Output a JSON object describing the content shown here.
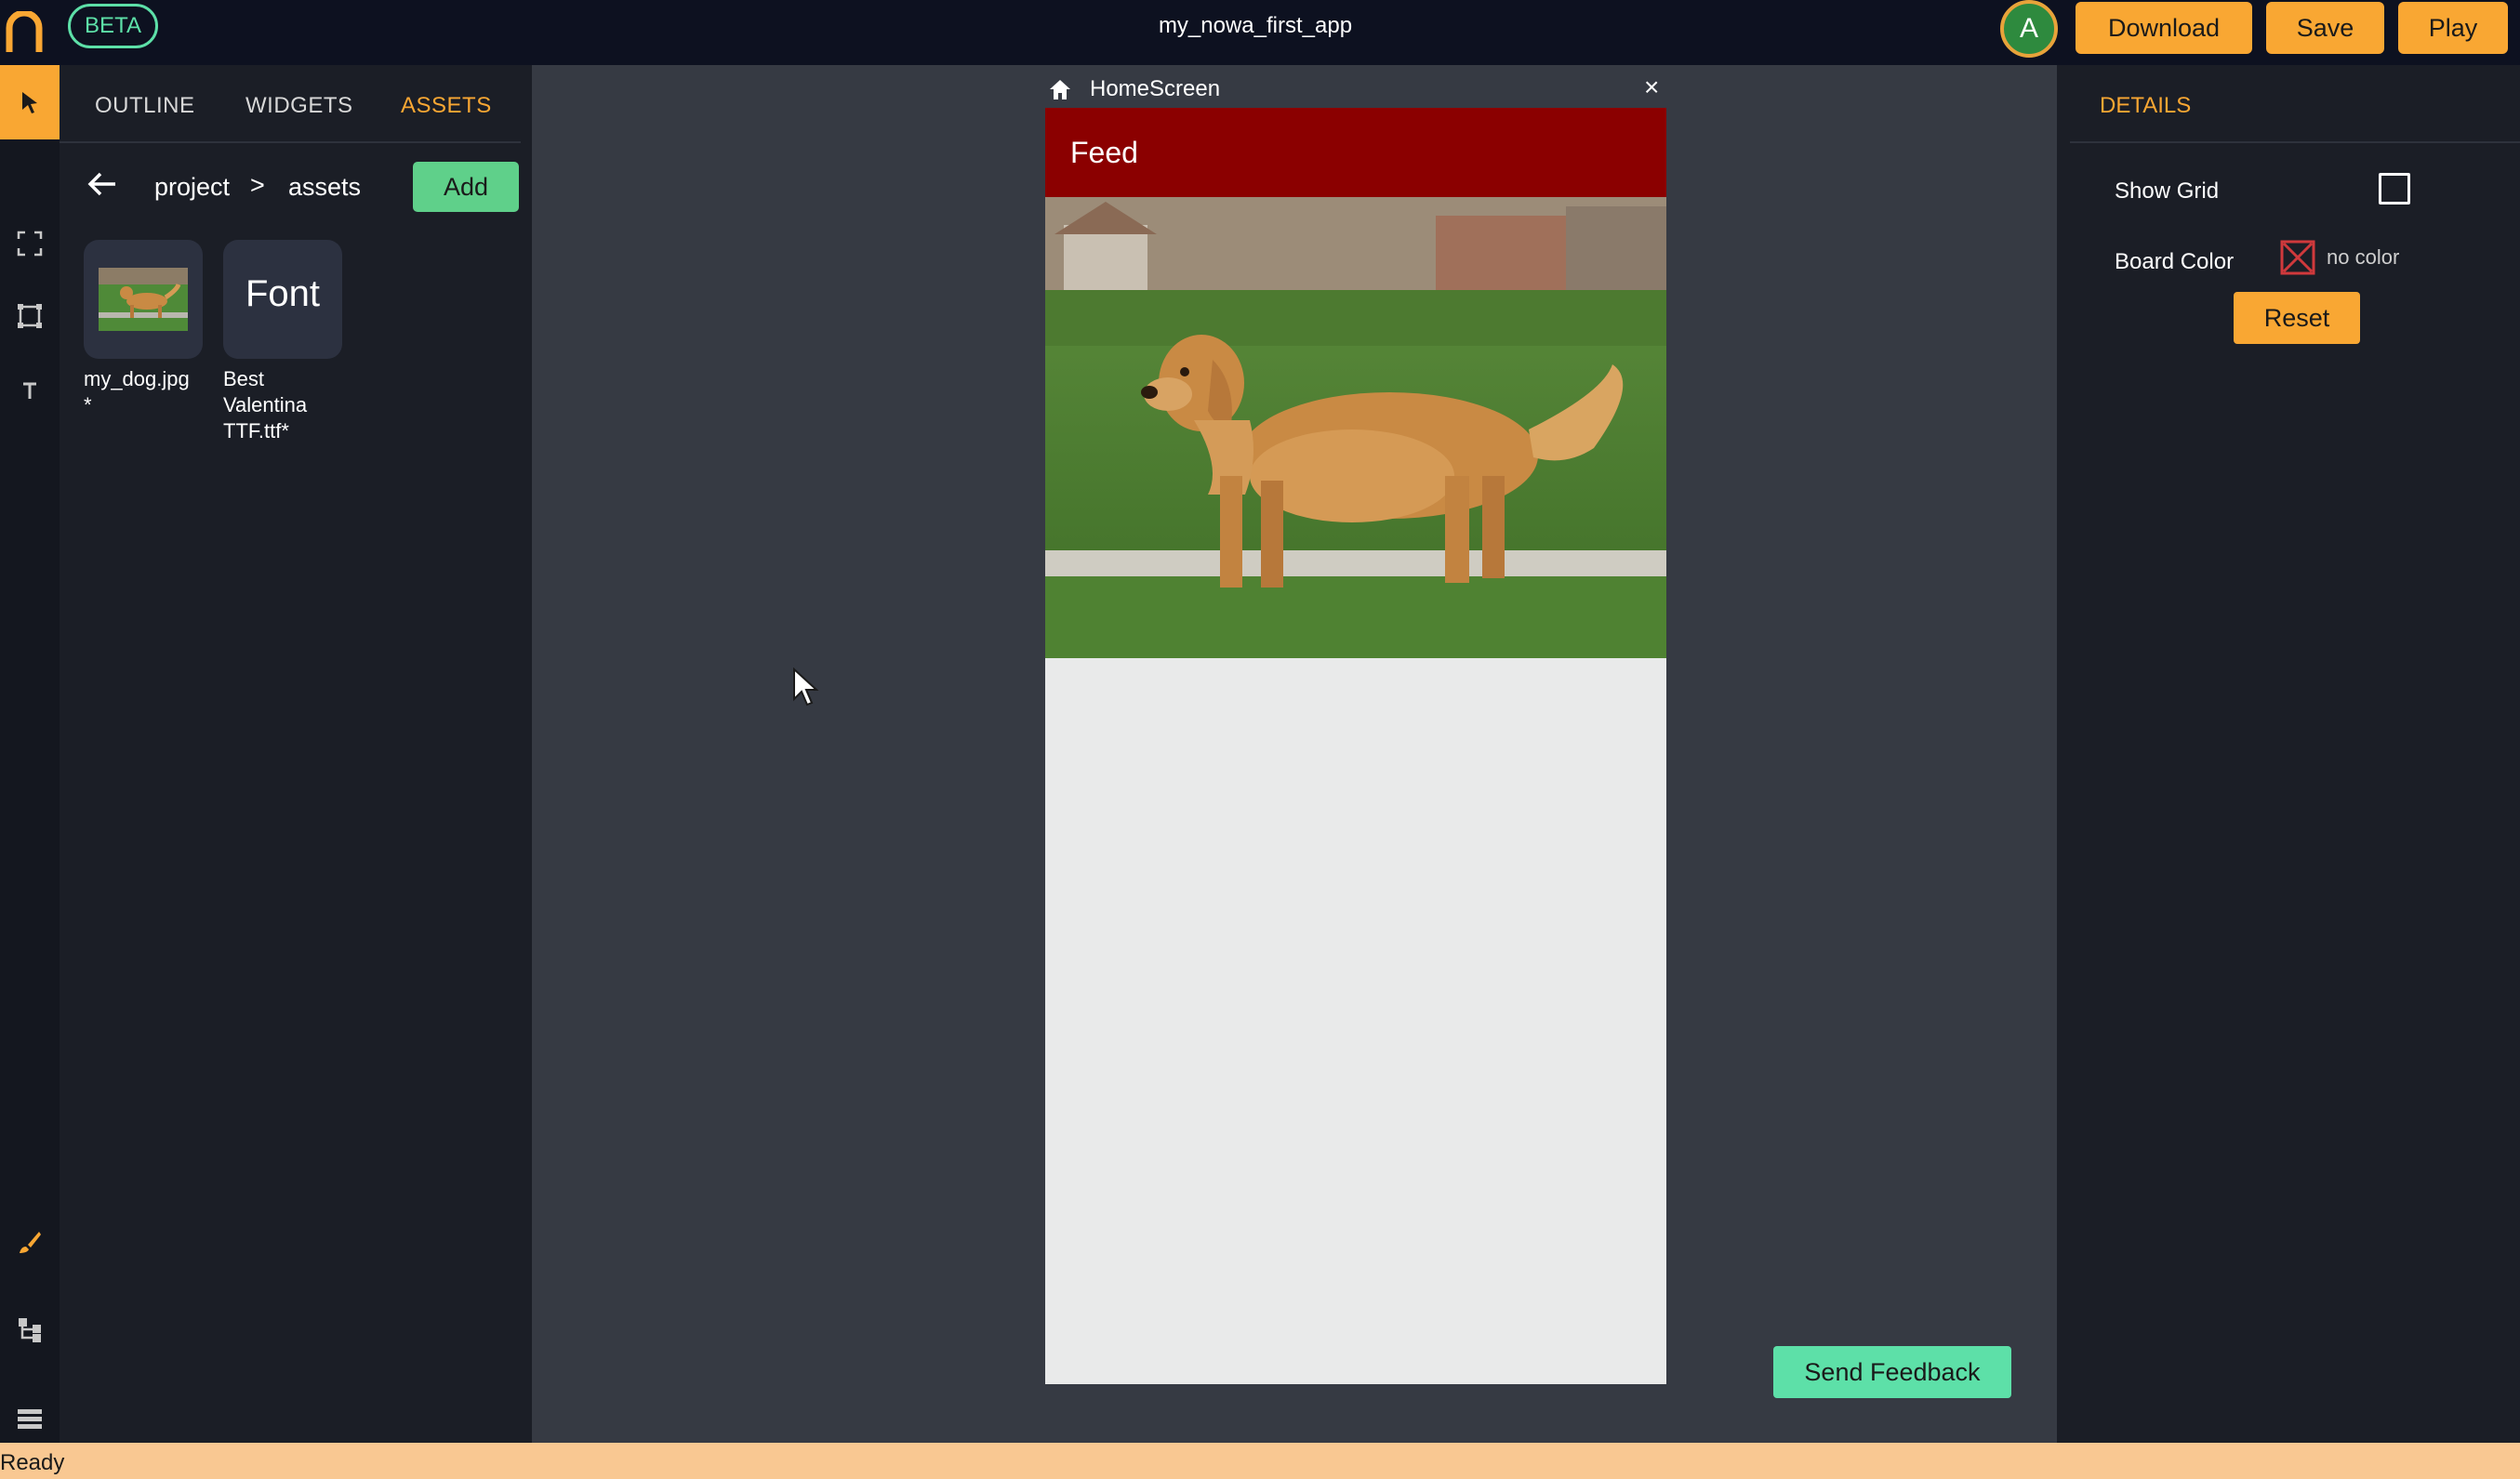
{
  "topbar": {
    "badge": "BETA",
    "app_title": "my_nowa_first_app",
    "avatar_letter": "A",
    "download_label": "Download",
    "save_label": "Save",
    "play_label": "Play"
  },
  "left_panel": {
    "tabs": [
      {
        "label": "OUTLINE",
        "active": false
      },
      {
        "label": "WIDGETS",
        "active": false
      },
      {
        "label": "ASSETS",
        "active": true
      }
    ],
    "breadcrumb": {
      "root": "project",
      "separator": ">",
      "current": "assets"
    },
    "add_label": "Add",
    "assets": [
      {
        "name": "my_dog.jpg*",
        "kind": "image"
      },
      {
        "name": "Best Valentina TTF.ttf*",
        "kind": "font",
        "tile_label": "Font"
      }
    ]
  },
  "tools": {
    "top": [
      "cursor-select-icon",
      "fullscreen-frame-icon",
      "rectangle-icon",
      "text-icon"
    ],
    "bottom": [
      "brush-icon",
      "tree-icon",
      "list-icon"
    ]
  },
  "canvas": {
    "screen_name": "HomeScreen",
    "close_glyph": "×",
    "appbar_title": "Feed",
    "appbar_color": "#8b0000"
  },
  "right_panel": {
    "title": "DETAILS",
    "show_grid_label": "Show Grid",
    "show_grid_checked": false,
    "board_color_label": "Board Color",
    "board_color_value": "no color",
    "reset_label": "Reset"
  },
  "feedback_label": "Send Feedback",
  "status": "Ready",
  "colors": {
    "accent": "#f9a733",
    "green": "#5fd08a",
    "mint": "#5de0a8",
    "background": "#363a43",
    "panel": "#1b1e26"
  }
}
